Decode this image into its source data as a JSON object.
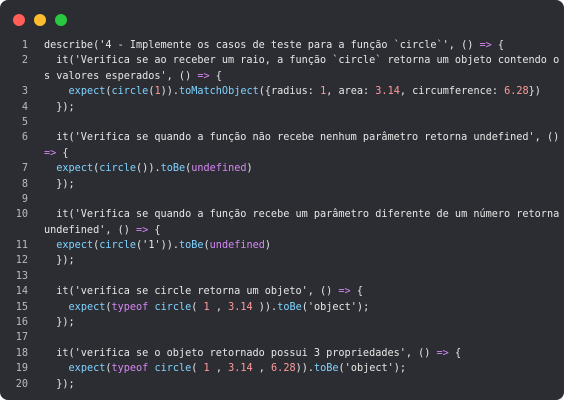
{
  "window": {
    "controls": [
      "close",
      "minimize",
      "zoom"
    ],
    "colors": {
      "background": "#2c2d33",
      "close": "#ff5f57",
      "minimize": "#febc2e",
      "zoom": "#28c840"
    }
  },
  "syntax_colors": {
    "plain": "#e6e6e6",
    "keyword_arrow": "#d587f2",
    "function": "#7fd3ff",
    "number": "#ff9a9a",
    "line_number": "#b9b9be"
  },
  "lines": [
    {
      "n": "1",
      "tokens": [
        {
          "t": "describe('4 - Implemente os casos de teste para a função `circle`', () ",
          "c": "s"
        },
        {
          "t": "=>",
          "c": "a"
        },
        {
          "t": " {",
          "c": "s"
        }
      ]
    },
    {
      "n": "2",
      "tokens": [
        {
          "t": "  it('Verifica se ao receber um raio, a função `circle` retorna um objeto contendo o",
          "c": "s"
        }
      ]
    },
    {
      "n": "",
      "tokens": [
        {
          "t": "s valores esperados', () ",
          "c": "s"
        },
        {
          "t": "=>",
          "c": "a"
        },
        {
          "t": " {",
          "c": "s"
        }
      ]
    },
    {
      "n": "3",
      "tokens": [
        {
          "t": "    ",
          "c": "s"
        },
        {
          "t": "expect",
          "c": "f"
        },
        {
          "t": "(",
          "c": "s"
        },
        {
          "t": "circle",
          "c": "f"
        },
        {
          "t": "(",
          "c": "s"
        },
        {
          "t": "1",
          "c": "n"
        },
        {
          "t": ")).",
          "c": "s"
        },
        {
          "t": "toMatchObject",
          "c": "f"
        },
        {
          "t": "({radius: ",
          "c": "s"
        },
        {
          "t": "1",
          "c": "n"
        },
        {
          "t": ", area: ",
          "c": "s"
        },
        {
          "t": "3.14",
          "c": "n"
        },
        {
          "t": ", circumference: ",
          "c": "s"
        },
        {
          "t": "6.28",
          "c": "n"
        },
        {
          "t": "})",
          "c": "s"
        }
      ]
    },
    {
      "n": "4",
      "tokens": [
        {
          "t": "  });",
          "c": "s"
        }
      ]
    },
    {
      "n": "5",
      "tokens": []
    },
    {
      "n": "6",
      "tokens": [
        {
          "t": "  it('Verifica se quando a função não recebe nenhum parâmetro retorna undefined', ()",
          "c": "s"
        }
      ]
    },
    {
      "n": "",
      "tokens": [
        {
          "t": "=>",
          "c": "a"
        },
        {
          "t": " {",
          "c": "s"
        }
      ]
    },
    {
      "n": "7",
      "tokens": [
        {
          "t": "  ",
          "c": "s"
        },
        {
          "t": "expect",
          "c": "f"
        },
        {
          "t": "(",
          "c": "s"
        },
        {
          "t": "circle",
          "c": "f"
        },
        {
          "t": "()).",
          "c": "s"
        },
        {
          "t": "toBe",
          "c": "f"
        },
        {
          "t": "(",
          "c": "s"
        },
        {
          "t": "undefined",
          "c": "k"
        },
        {
          "t": ")",
          "c": "s"
        }
      ]
    },
    {
      "n": "8",
      "tokens": [
        {
          "t": "  });",
          "c": "s"
        }
      ]
    },
    {
      "n": "9",
      "tokens": []
    },
    {
      "n": "10",
      "tokens": [
        {
          "t": "  it('Verifica se quando a função recebe um parâmetro diferente de um número retorna",
          "c": "s"
        }
      ]
    },
    {
      "n": "",
      "tokens": [
        {
          "t": "undefined', () ",
          "c": "s"
        },
        {
          "t": "=>",
          "c": "a"
        },
        {
          "t": " {",
          "c": "s"
        }
      ]
    },
    {
      "n": "11",
      "tokens": [
        {
          "t": "  ",
          "c": "s"
        },
        {
          "t": "expect",
          "c": "f"
        },
        {
          "t": "(",
          "c": "s"
        },
        {
          "t": "circle",
          "c": "f"
        },
        {
          "t": "('1')).",
          "c": "s"
        },
        {
          "t": "toBe",
          "c": "f"
        },
        {
          "t": "(",
          "c": "s"
        },
        {
          "t": "undefined",
          "c": "k"
        },
        {
          "t": ")",
          "c": "s"
        }
      ]
    },
    {
      "n": "12",
      "tokens": [
        {
          "t": "  });",
          "c": "s"
        }
      ]
    },
    {
      "n": "13",
      "tokens": []
    },
    {
      "n": "14",
      "tokens": [
        {
          "t": "  it('verifica se circle retorna um objeto', () ",
          "c": "s"
        },
        {
          "t": "=>",
          "c": "a"
        },
        {
          "t": " {",
          "c": "s"
        }
      ]
    },
    {
      "n": "15",
      "tokens": [
        {
          "t": "    ",
          "c": "s"
        },
        {
          "t": "expect",
          "c": "f"
        },
        {
          "t": "(",
          "c": "s"
        },
        {
          "t": "typeof",
          "c": "k"
        },
        {
          "t": " ",
          "c": "s"
        },
        {
          "t": "circle",
          "c": "f"
        },
        {
          "t": "( ",
          "c": "s"
        },
        {
          "t": "1",
          "c": "n"
        },
        {
          "t": " , ",
          "c": "s"
        },
        {
          "t": "3.14",
          "c": "n"
        },
        {
          "t": " )).",
          "c": "s"
        },
        {
          "t": "toBe",
          "c": "f"
        },
        {
          "t": "('object');",
          "c": "s"
        }
      ]
    },
    {
      "n": "16",
      "tokens": [
        {
          "t": "  });",
          "c": "s"
        }
      ]
    },
    {
      "n": "17",
      "tokens": []
    },
    {
      "n": "18",
      "tokens": [
        {
          "t": "  it('verifica se o objeto retornado possui 3 propriedades', () ",
          "c": "s"
        },
        {
          "t": "=>",
          "c": "a"
        },
        {
          "t": " {",
          "c": "s"
        }
      ]
    },
    {
      "n": "19",
      "tokens": [
        {
          "t": "    ",
          "c": "s"
        },
        {
          "t": "expect",
          "c": "f"
        },
        {
          "t": "(",
          "c": "s"
        },
        {
          "t": "typeof",
          "c": "k"
        },
        {
          "t": " ",
          "c": "s"
        },
        {
          "t": "circle",
          "c": "f"
        },
        {
          "t": "( ",
          "c": "s"
        },
        {
          "t": "1",
          "c": "n"
        },
        {
          "t": " , ",
          "c": "s"
        },
        {
          "t": "3.14",
          "c": "n"
        },
        {
          "t": " , ",
          "c": "s"
        },
        {
          "t": "6.28",
          "c": "n"
        },
        {
          "t": ")).",
          "c": "s"
        },
        {
          "t": "toBe",
          "c": "f"
        },
        {
          "t": "('object');",
          "c": "s"
        }
      ]
    },
    {
      "n": "20",
      "tokens": [
        {
          "t": "  });",
          "c": "s"
        }
      ]
    }
  ]
}
